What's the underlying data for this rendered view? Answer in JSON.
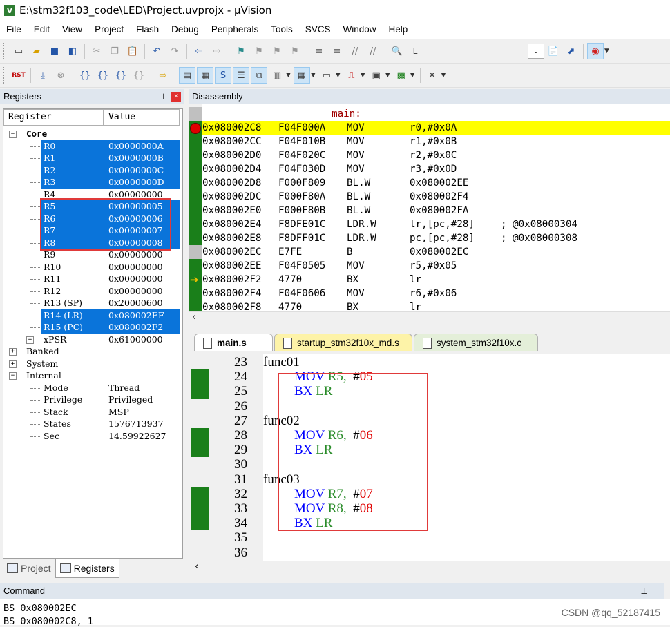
{
  "window": {
    "title": "E:\\stm32f103_code\\LED\\Project.uvprojx - µVision",
    "app_icon": "V"
  },
  "menu": [
    "File",
    "Edit",
    "View",
    "Project",
    "Flash",
    "Debug",
    "Peripherals",
    "Tools",
    "SVCS",
    "Window",
    "Help"
  ],
  "toolbar1": {
    "find_label": "L"
  },
  "toolbar2": {
    "reset_label": "RST"
  },
  "registers_panel": {
    "title": "Registers",
    "col_register": "Register",
    "col_value": "Value",
    "core_label": "Core",
    "core_regs": [
      {
        "name": "R0",
        "value": "0x0000000A"
      },
      {
        "name": "R1",
        "value": "0x0000000B"
      },
      {
        "name": "R2",
        "value": "0x0000000C"
      },
      {
        "name": "R3",
        "value": "0x0000000D"
      },
      {
        "name": "R4",
        "value": "0x00000000"
      },
      {
        "name": "R5",
        "value": "0x00000005"
      },
      {
        "name": "R6",
        "value": "0x00000006"
      },
      {
        "name": "R7",
        "value": "0x00000007"
      },
      {
        "name": "R8",
        "value": "0x00000008"
      },
      {
        "name": "R9",
        "value": "0x00000000"
      },
      {
        "name": "R10",
        "value": "0x00000000"
      },
      {
        "name": "R11",
        "value": "0x00000000"
      },
      {
        "name": "R12",
        "value": "0x00000000"
      },
      {
        "name": "R13 (SP)",
        "value": "0x20000600"
      },
      {
        "name": "R14 (LR)",
        "value": "0x080002EF"
      },
      {
        "name": "R15 (PC)",
        "value": "0x080002F2"
      },
      {
        "name": "xPSR",
        "value": "0x61000000"
      }
    ],
    "banked_label": "Banked",
    "system_label": "System",
    "internal_label": "Internal",
    "internal": [
      {
        "name": "Mode",
        "value": "Thread"
      },
      {
        "name": "Privilege",
        "value": "Privileged"
      },
      {
        "name": "Stack",
        "value": "MSP"
      },
      {
        "name": "States",
        "value": "1576713937"
      },
      {
        "name": "Sec",
        "value": "14.59922627"
      }
    ]
  },
  "bottom_tabs": {
    "project": "Project",
    "registers": "Registers"
  },
  "disassembly": {
    "title": "Disassembly",
    "label": "__main:",
    "lines": [
      {
        "addr": "0x080002C8",
        "code": "F04F000A",
        "mnem": "MOV",
        "ops": "r0,#0x0A",
        "comment": ""
      },
      {
        "addr": "0x080002CC",
        "code": "F04F010B",
        "mnem": "MOV",
        "ops": "r1,#0x0B",
        "comment": ""
      },
      {
        "addr": "0x080002D0",
        "code": "F04F020C",
        "mnem": "MOV",
        "ops": "r2,#0x0C",
        "comment": ""
      },
      {
        "addr": "0x080002D4",
        "code": "F04F030D",
        "mnem": "MOV",
        "ops": "r3,#0x0D",
        "comment": ""
      },
      {
        "addr": "0x080002D8",
        "code": "F000F809",
        "mnem": "BL.W",
        "ops": "0x080002EE",
        "comment": ""
      },
      {
        "addr": "0x080002DC",
        "code": "F000F80A",
        "mnem": "BL.W",
        "ops": "0x080002F4",
        "comment": ""
      },
      {
        "addr": "0x080002E0",
        "code": "F000F80B",
        "mnem": "BL.W",
        "ops": "0x080002FA",
        "comment": ""
      },
      {
        "addr": "0x080002E4",
        "code": "F8DFE01C",
        "mnem": "LDR.W",
        "ops": "lr,[pc,#28]",
        "comment": "; @0x08000304"
      },
      {
        "addr": "0x080002E8",
        "code": "F8DFF01C",
        "mnem": "LDR.W",
        "ops": "pc,[pc,#28]",
        "comment": "; @0x08000308"
      },
      {
        "addr": "0x080002EC",
        "code": "E7FE",
        "mnem": "B",
        "ops": "0x080002EC",
        "comment": ""
      },
      {
        "addr": "0x080002EE",
        "code": "F04F0505",
        "mnem": "MOV",
        "ops": "r5,#0x05",
        "comment": ""
      },
      {
        "addr": "0x080002F2",
        "code": "4770",
        "mnem": "BX",
        "ops": "lr",
        "comment": ""
      },
      {
        "addr": "0x080002F4",
        "code": "F04F0606",
        "mnem": "MOV",
        "ops": "r6,#0x06",
        "comment": ""
      },
      {
        "addr": "0x080002F8",
        "code": "4770",
        "mnem": "BX",
        "ops": "lr",
        "comment": ""
      }
    ]
  },
  "editor_tabs": [
    "main.s",
    "startup_stm32f10x_md.s",
    "system_stm32f10x.c"
  ],
  "editor": {
    "lines": [
      {
        "n": "23",
        "label": "func01",
        "mn": "",
        "rg": "",
        "hash": "",
        "nm": ""
      },
      {
        "n": "24",
        "label": "",
        "mn": "MOV",
        "rg": "R5,",
        "hash": "#",
        "nm": "05"
      },
      {
        "n": "25",
        "label": "",
        "mn": "BX",
        "rg": "LR",
        "hash": "",
        "nm": ""
      },
      {
        "n": "26",
        "label": "",
        "mn": "",
        "rg": "",
        "hash": "",
        "nm": ""
      },
      {
        "n": "27",
        "label": "func02",
        "mn": "",
        "rg": "",
        "hash": "",
        "nm": ""
      },
      {
        "n": "28",
        "label": "",
        "mn": "MOV",
        "rg": "R6,",
        "hash": "#",
        "nm": "06"
      },
      {
        "n": "29",
        "label": "",
        "mn": "BX",
        "rg": "LR",
        "hash": "",
        "nm": ""
      },
      {
        "n": "30",
        "label": "",
        "mn": "",
        "rg": "",
        "hash": "",
        "nm": ""
      },
      {
        "n": "31",
        "label": "func03",
        "mn": "",
        "rg": "",
        "hash": "",
        "nm": ""
      },
      {
        "n": "32",
        "label": "",
        "mn": "MOV",
        "rg": "R7,",
        "hash": "#",
        "nm": "07"
      },
      {
        "n": "33",
        "label": "",
        "mn": "MOV",
        "rg": "R8,",
        "hash": "#",
        "nm": "08"
      },
      {
        "n": "34",
        "label": "",
        "mn": "BX",
        "rg": "LR",
        "hash": "",
        "nm": ""
      },
      {
        "n": "35",
        "label": "",
        "mn": "",
        "rg": "",
        "hash": "",
        "nm": ""
      },
      {
        "n": "36",
        "label": "",
        "mn": "",
        "rg": "",
        "hash": "",
        "nm": ""
      }
    ]
  },
  "command": {
    "title": "Command",
    "lines": [
      "BS 0x080002EC",
      "BS 0x080002C8, 1"
    ]
  },
  "watermark": "CSDN @qq_52187415",
  "colors": {
    "highlight": "#0a74da",
    "current_line": "#ffff00",
    "breakpoint": "#e00000",
    "exec_mark": "#1a7f1a",
    "annotation_box": "#e03a3a"
  }
}
